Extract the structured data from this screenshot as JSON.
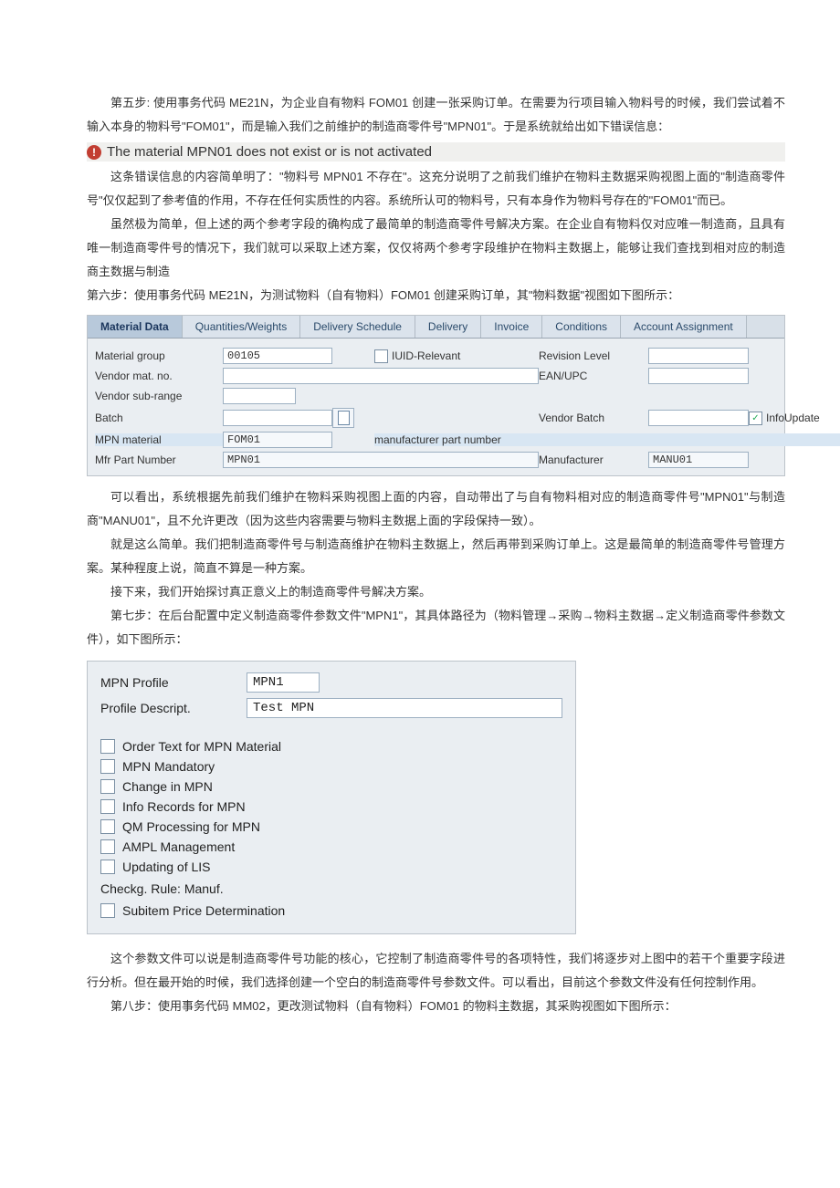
{
  "para": {
    "step5": "第五步: 使用事务代码 ME21N，为企业自有物料 FOM01 创建一张采购订单。在需要为行项目输入物料号的时候，我们尝试着不输入本身的物料号\"FOM01\"，而是输入我们之前维护的制造商零件号\"MPN01\"。于是系统就给出如下错误信息：",
    "expl1": "这条错误信息的内容简单明了：\"物料号 MPN01 不存在\"。这充分说明了之前我们维护在物料主数据采购视图上面的\"制造商零件号\"仅仅起到了参考值的作用，不存在任何实质性的内容。系统所认可的物料号，只有本身作为物料号存在的\"FOM01\"而已。",
    "expl2": "虽然极为简单，但上述的两个参考字段的确构成了最简单的制造商零件号解决方案。在企业自有物料仅对应唯一制造商，且具有唯一制造商零件号的情况下，我们就可以采取上述方案，仅仅将两个参考字段维护在物料主数据上，能够让我们查找到相对应的制造商主数据与制造",
    "step6": "第六步：使用事务代码 ME21N，为测试物料（自有物料）FOM01 创建采购订单，其\"物料数据\"视图如下图所示：",
    "after1": "可以看出，系统根据先前我们维护在物料采购视图上面的内容，自动带出了与自有物料相对应的制造商零件号\"MPN01\"与制造商\"MANU01\"，且不允许更改（因为这些内容需要与物料主数据上面的字段保持一致）。",
    "after2": "就是这么简单。我们把制造商零件号与制造商维护在物料主数据上，然后再带到采购订单上。这是最简单的制造商零件号管理方案。某种程度上说，简直不算是一种方案。",
    "after3": "接下来，我们开始探讨真正意义上的制造商零件号解决方案。",
    "step7": "第七步：在后台配置中定义制造商零件参数文件\"MPN1\"，其具体路径为（物料管理→采购→物料主数据→定义制造商零件参数文件），如下图所示：",
    "after4": "这个参数文件可以说是制造商零件号功能的核心，它控制了制造商零件号的各项特性，我们将逐步对上图中的若干个重要字段进行分析。但在最开始的时候，我们选择创建一个空白的制造商零件号参数文件。可以看出，目前这个参数文件没有任何控制作用。",
    "step8": "第八步：使用事务代码 MM02，更改测试物料（自有物料）FOM01 的物料主数据，其采购视图如下图所示："
  },
  "error": {
    "icon": "!",
    "text": "The material MPN01 does not exist or is not activated"
  },
  "sap": {
    "tabs": [
      "Material Data",
      "Quantities/Weights",
      "Delivery Schedule",
      "Delivery",
      "Invoice",
      "Conditions",
      "Account Assignment"
    ],
    "labels": {
      "matgroup": "Material group",
      "vendormatno": "Vendor mat. no.",
      "subrange": "Vendor sub-range",
      "batch": "Batch",
      "mpnmat": "MPN material",
      "mfrpart": "Mfr Part Number",
      "iuid": "IUID-Relevant",
      "revlvl": "Revision Level",
      "eanupc": "EAN/UPC",
      "vendorbatch": "Vendor Batch",
      "infoupdate": "InfoUpdate",
      "mfrpartnum": "manufacturer part number",
      "manufacturer": "Manufacturer"
    },
    "values": {
      "matgroup": "00105",
      "mpnmat": "FOM01",
      "mfrpart": "MPN01",
      "manufacturer": "MANU01"
    }
  },
  "mpn": {
    "labels": {
      "profile": "MPN Profile",
      "desc": "Profile Descript.",
      "checkg": "Checkg. Rule: Manuf."
    },
    "values": {
      "profile": "MPN1",
      "desc": "Test MPN"
    },
    "options": [
      "Order Text for MPN Material",
      "MPN Mandatory",
      "Change in MPN",
      "Info Records for MPN",
      "QM Processing for MPN",
      "AMPL Management",
      "Updating of LIS"
    ],
    "last": "Subitem Price Determination"
  }
}
